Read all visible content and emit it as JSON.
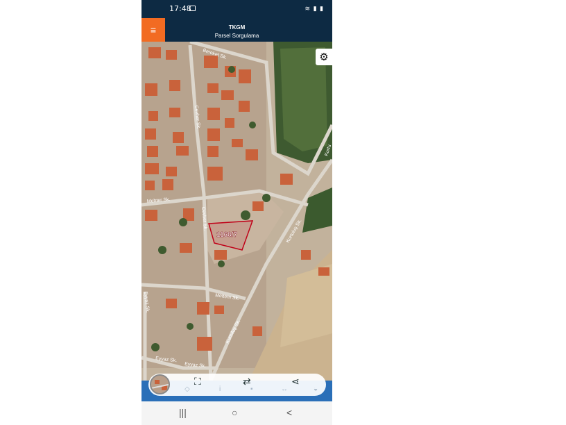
{
  "status_bar": {
    "time": "17:48",
    "icons": [
      "gallery-icon",
      "wifi-icon",
      "signal-icon",
      "battery-icon"
    ]
  },
  "app_bar": {
    "title": "TKGM",
    "subtitle": "Parsel Sorgulama",
    "menu_icon": "menu-icon",
    "accent": "#f26b22",
    "background": "#0d2a43"
  },
  "map": {
    "parcel_label": "1168/7",
    "parcel_color": "#c00018",
    "streets": [
      "Bereket Sk.",
      "Cevher Sk.",
      "Mehter Sk.",
      "Cevher Sk.",
      "Kurtuluş Sk.",
      "Meltem Sk.",
      "Eyyaz Sk.",
      "Kurtuluş Sk.",
      "Eyyaz Sk.",
      "Eyyaz Sk.",
      "Kurtu"
    ]
  },
  "settings_icon": "gear-icon",
  "toolbar": {
    "icons": [
      "parcel-thumbnail",
      "scan-icon",
      "swap-icon",
      "share-icon"
    ],
    "faint_icons": [
      "diamond-icon",
      "info-icon",
      "car-icon",
      "ruler-icon",
      "layer-icon"
    ],
    "color": "#2a6fb8"
  },
  "nav_bar": {
    "recents": "|||",
    "home": "○",
    "back": "<"
  }
}
